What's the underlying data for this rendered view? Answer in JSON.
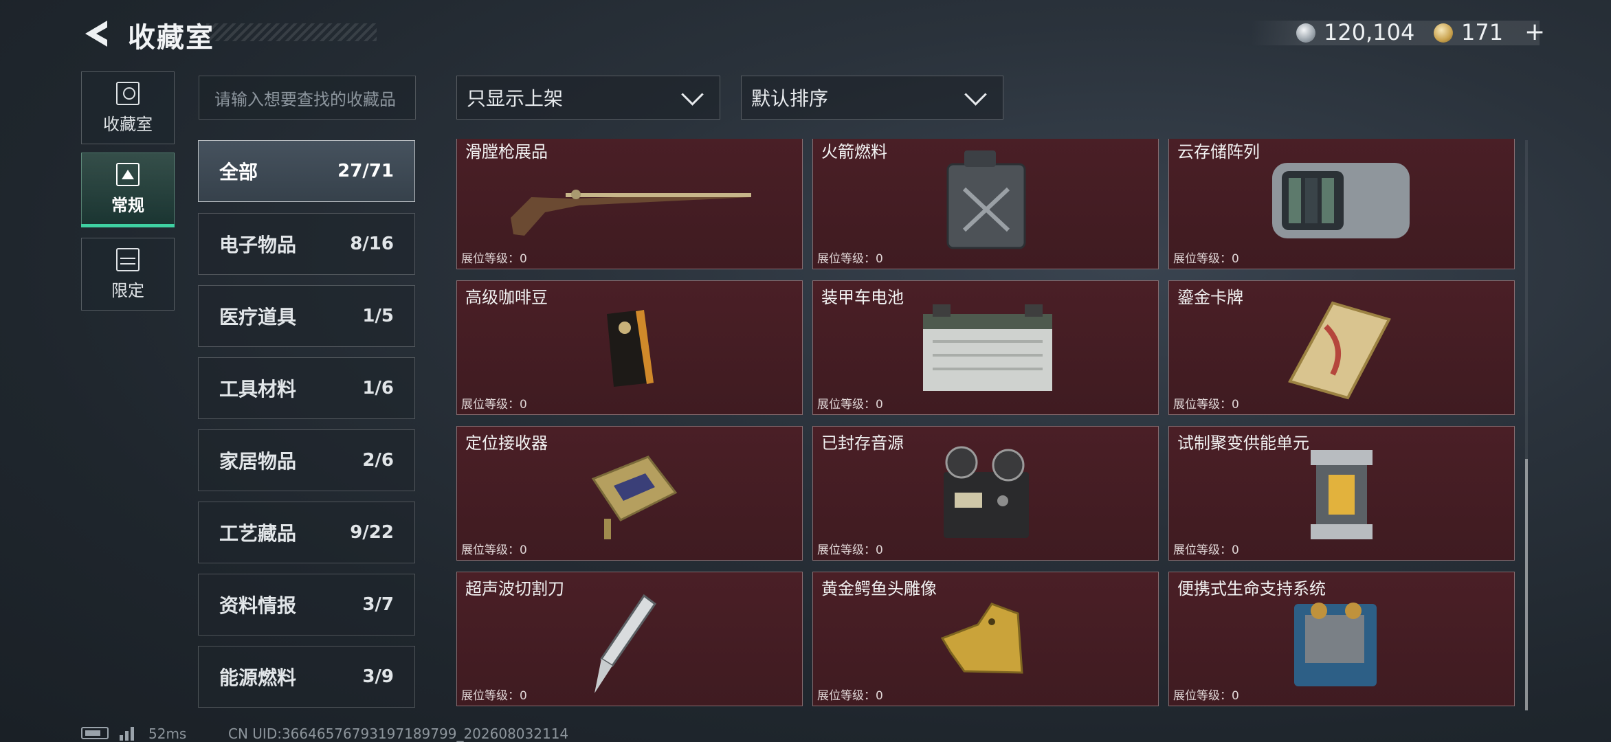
{
  "header": {
    "title": "收藏室"
  },
  "currency": {
    "silver": "120,104",
    "gold": "171",
    "plus": "+"
  },
  "nav": [
    {
      "label": "收藏室",
      "icon": "collection-room-icon"
    },
    {
      "label": "常规",
      "icon": "regular-icon",
      "active": true
    },
    {
      "label": "限定",
      "icon": "limited-icon"
    }
  ],
  "search": {
    "placeholder": "请输入想要查找的收藏品"
  },
  "filters": {
    "display": "只显示上架",
    "sort": "默认排序"
  },
  "categories": [
    {
      "label": "全部",
      "count": "27/71",
      "active": true
    },
    {
      "label": "电子物品",
      "count": "8/16"
    },
    {
      "label": "医疗道具",
      "count": "1/5"
    },
    {
      "label": "工具材料",
      "count": "1/6"
    },
    {
      "label": "家居物品",
      "count": "2/6"
    },
    {
      "label": "工艺藏品",
      "count": "9/22"
    },
    {
      "label": "资料情报",
      "count": "3/7"
    },
    {
      "label": "能源燃料",
      "count": "3/9"
    }
  ],
  "items": [
    {
      "name": "滑膛枪展品",
      "level": "展位等级：0",
      "icon": "musket-icon"
    },
    {
      "name": "火箭燃料",
      "level": "展位等级：0",
      "icon": "fuel-canister-icon"
    },
    {
      "name": "云存储阵列",
      "level": "展位等级：0",
      "icon": "storage-array-icon"
    },
    {
      "name": "高级咖啡豆",
      "level": "展位等级：0",
      "icon": "coffee-bag-icon"
    },
    {
      "name": "装甲车电池",
      "level": "展位等级：0",
      "icon": "battery-icon"
    },
    {
      "name": "鎏金卡牌",
      "level": "展位等级：0",
      "icon": "gilded-card-icon"
    },
    {
      "name": "定位接收器",
      "level": "展位等级：0",
      "icon": "receiver-icon"
    },
    {
      "name": "已封存音源",
      "level": "展位等级：0",
      "icon": "reel-recorder-icon"
    },
    {
      "name": "试制聚变供能单元",
      "level": "展位等级：0",
      "icon": "fusion-cell-icon"
    },
    {
      "name": "超声波切割刀",
      "level": "展位等级：0",
      "icon": "ultrasonic-knife-icon"
    },
    {
      "name": "黄金鳄鱼头雕像",
      "level": "展位等级：0",
      "icon": "gold-crocodile-icon"
    },
    {
      "name": "便携式生命支持系统",
      "level": "展位等级：0",
      "icon": "life-support-icon"
    }
  ],
  "footer": {
    "ping": "52ms",
    "uid": "CN UID:36646576793197189799_202608032114"
  }
}
